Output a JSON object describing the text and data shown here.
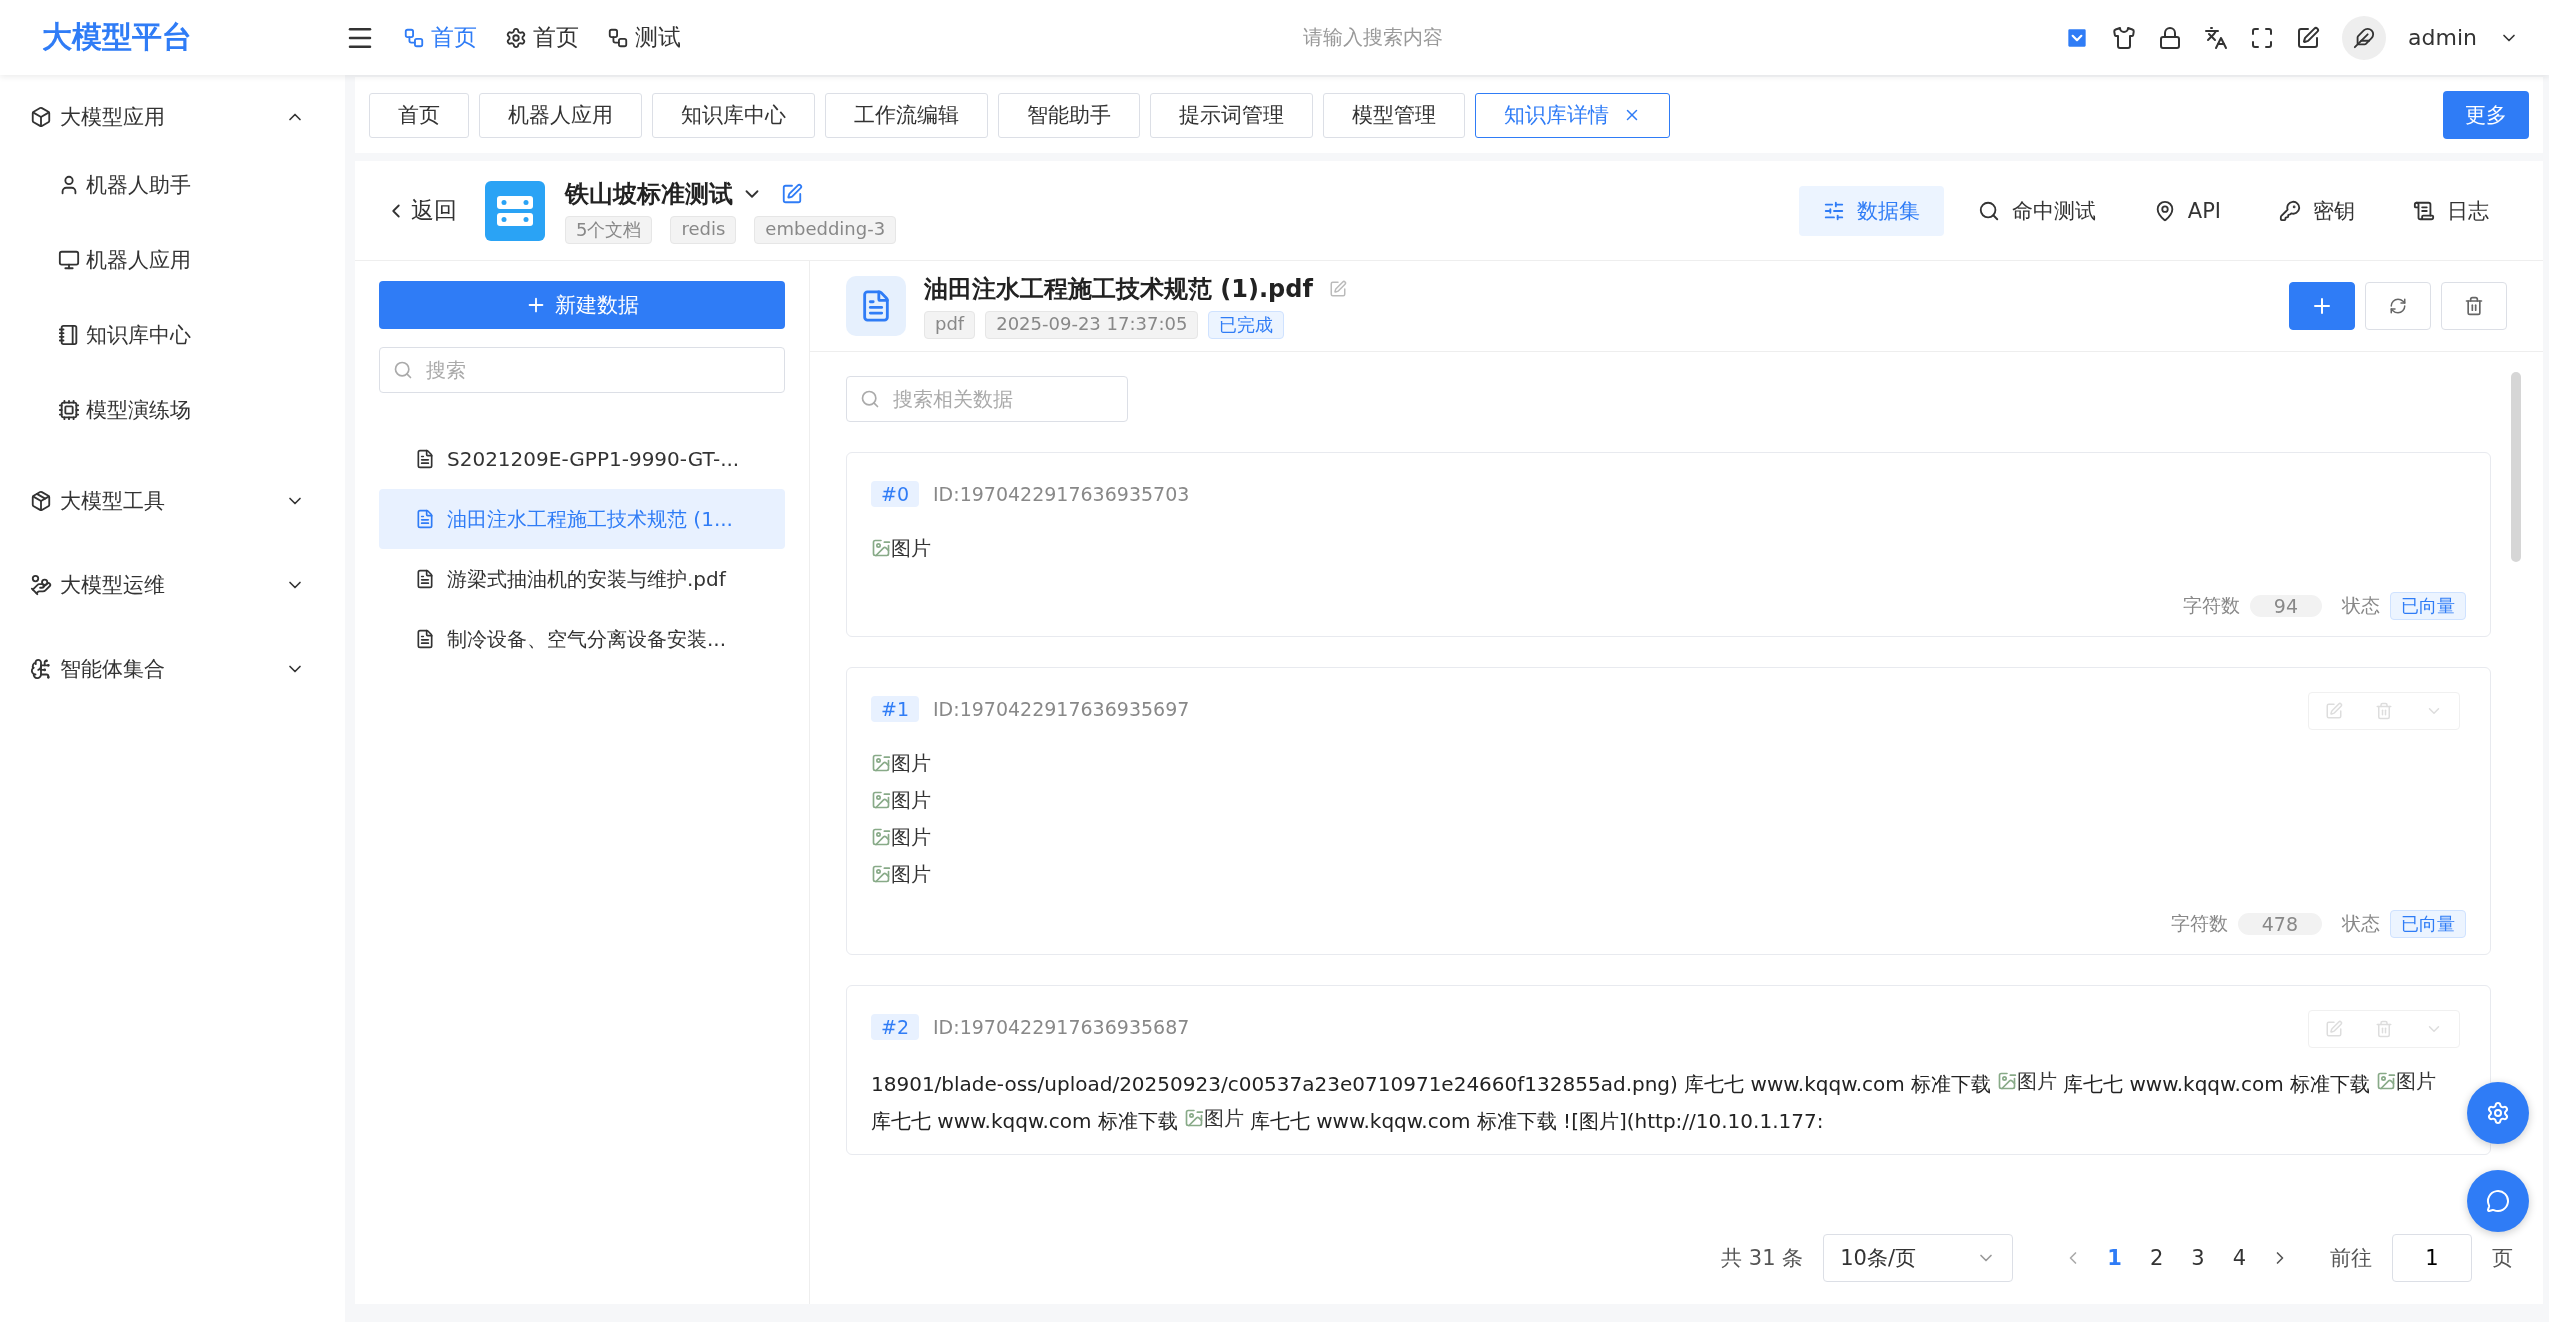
{
  "app": {
    "logo": "大模型平台"
  },
  "top_nav": [
    {
      "label": "首页",
      "kind": "flow",
      "selected": true
    },
    {
      "label": "首页",
      "kind": "gear",
      "selected": false
    },
    {
      "label": "测试",
      "kind": "flow",
      "selected": false
    }
  ],
  "search": {
    "placeholder": "请输入搜索内容"
  },
  "user": {
    "name": "admin"
  },
  "sidebar": [
    {
      "label": "大模型应用",
      "kind": "cube",
      "expanded": true,
      "children": [
        {
          "label": "机器人助手",
          "kind": "user"
        },
        {
          "label": "机器人应用",
          "kind": "monitor"
        },
        {
          "label": "知识库中心",
          "kind": "notebook"
        },
        {
          "label": "模型演练场",
          "kind": "chip"
        }
      ]
    },
    {
      "label": "大模型工具",
      "kind": "package",
      "expanded": false
    },
    {
      "label": "大模型运维",
      "kind": "hand",
      "expanded": false
    },
    {
      "label": "智能体集合",
      "kind": "ai",
      "expanded": false
    }
  ],
  "tabs": [
    {
      "label": "首页",
      "selected": false,
      "closable": false
    },
    {
      "label": "机器人应用",
      "selected": false,
      "closable": false
    },
    {
      "label": "知识库中心",
      "selected": false,
      "closable": false
    },
    {
      "label": "工作流编辑",
      "selected": false,
      "closable": false
    },
    {
      "label": "智能助手",
      "selected": false,
      "closable": false
    },
    {
      "label": "提示词管理",
      "selected": false,
      "closable": false
    },
    {
      "label": "模型管理",
      "selected": false,
      "closable": false
    },
    {
      "label": "知识库详情",
      "selected": true,
      "closable": true
    }
  ],
  "more_button": "更多",
  "knowledge_base": {
    "back": "返回",
    "title": "铁山坡标准测试",
    "tags": [
      "5个文档",
      "redis",
      "embedding-3"
    ]
  },
  "views": [
    {
      "label": "数据集",
      "kind": "sliders",
      "selected": true
    },
    {
      "label": "命中测试",
      "kind": "search",
      "selected": false
    },
    {
      "label": "API",
      "kind": "pin",
      "selected": false
    },
    {
      "label": "密钥",
      "kind": "key",
      "selected": false
    },
    {
      "label": "日志",
      "kind": "log",
      "selected": false
    }
  ],
  "documents": {
    "new_button": "新建数据",
    "search_placeholder": "搜索",
    "items": [
      {
        "name": "S2021209E-GPP1-9990-GT-...",
        "selected": false
      },
      {
        "name": "油田注水工程施工技术规范 (1...",
        "selected": true
      },
      {
        "name": "游梁式抽油机的安装与维护.pdf",
        "selected": false
      },
      {
        "name": "制冷设备、空气分离设备安装...",
        "selected": false
      }
    ]
  },
  "detail": {
    "title": "油田注水工程施工技术规范 (1).pdf",
    "tags": [
      "pdf",
      "2025-09-23 17:37:05"
    ],
    "status": "已完成",
    "search_placeholder": "搜索相关数据"
  },
  "chunks": [
    {
      "index": "#0",
      "id": "ID:1970422917636935703",
      "show_actions": false,
      "content": [
        {
          "kind": "image",
          "alt": "图片"
        }
      ],
      "char_label": "字符数",
      "chars": "94",
      "status_label": "状态",
      "status": "已向量"
    },
    {
      "index": "#1",
      "id": "ID:1970422917636935697",
      "show_actions": true,
      "content": [
        {
          "kind": "image",
          "alt": "图片"
        },
        {
          "kind": "image",
          "alt": "图片"
        },
        {
          "kind": "image",
          "alt": "图片"
        },
        {
          "kind": "image",
          "alt": "图片"
        }
      ],
      "char_label": "字符数",
      "chars": "478",
      "status_label": "状态",
      "status": "已向量"
    },
    {
      "index": "#2",
      "id": "ID:1970422917636935687",
      "show_actions": true,
      "content": [
        {
          "kind": "text",
          "text": "18901/blade-oss/upload/20250923/c00537a23e0710971e24660f132855ad.png) 库七七 www.kqqw.com 标准下载"
        },
        {
          "kind": "image",
          "alt": "图片"
        },
        {
          "kind": "text",
          "text": "库七七 www.kqqw.com 标准下载"
        },
        {
          "kind": "image",
          "alt": "图片"
        },
        {
          "kind": "text",
          "text": "库七七 www.kqqw.com 标准下载"
        },
        {
          "kind": "image",
          "alt": "图片"
        },
        {
          "kind": "text",
          "text": "库七七 www.kqqw.com 标准下载 ![图片](http://10.10.1.177:"
        }
      ]
    }
  ],
  "pagination": {
    "total": "共 31 条",
    "page_size": "10条/页",
    "pages": [
      {
        "label": "1",
        "selected": true
      },
      {
        "label": "2",
        "selected": false
      },
      {
        "label": "3",
        "selected": false
      },
      {
        "label": "4",
        "selected": false
      }
    ],
    "goto_label": "前往",
    "goto_value": "1",
    "goto_suffix": "页"
  }
}
